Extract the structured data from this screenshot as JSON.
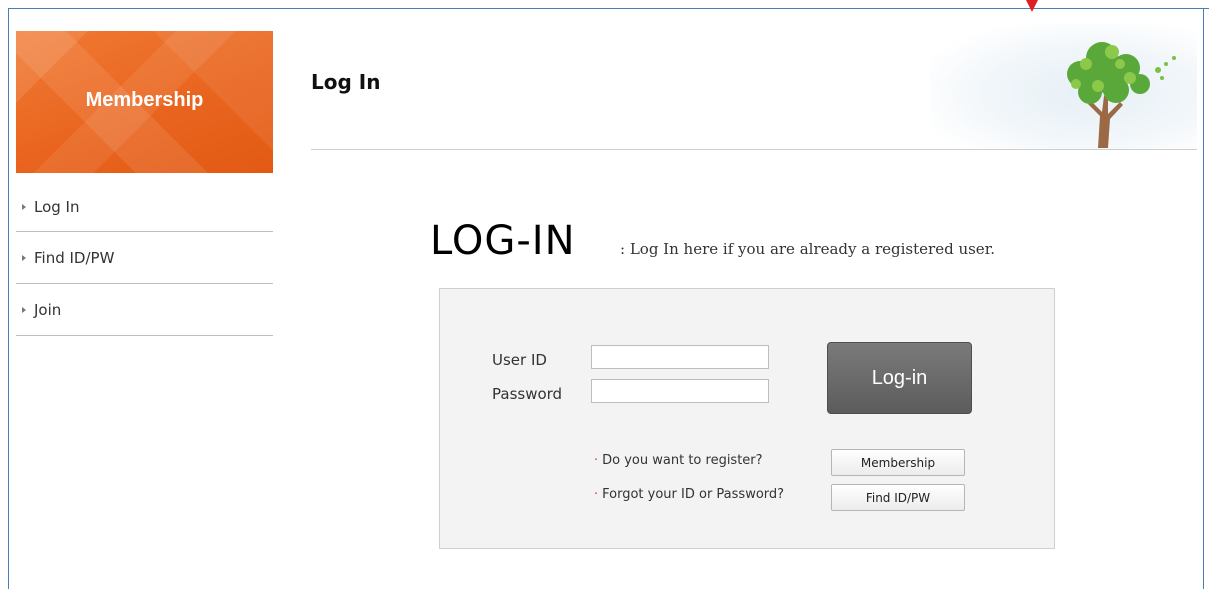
{
  "sidebar": {
    "banner_title": "Membership",
    "items": [
      {
        "label": "Log In"
      },
      {
        "label": "Find ID/PW"
      },
      {
        "label": "Join"
      }
    ]
  },
  "header": {
    "title": "Log In",
    "art_icon": "tree-illustration"
  },
  "login": {
    "heading": "LOG-IN",
    "subheading": ": Log In here if you are already a registered user.",
    "user_id_label": "User ID",
    "user_id_value": "",
    "password_label": "Password",
    "password_value": "",
    "submit_label": "Log-in",
    "register_prompt": "Do you want to register?",
    "register_button": "Membership",
    "forgot_prompt": "Forgot your ID or Password?",
    "forgot_button": "Find ID/PW"
  },
  "colors": {
    "banner": "#e9651f",
    "frame": "#4a7ebb",
    "marker": "#e02020",
    "login_button": "#666666",
    "bullet": "#d24a2a"
  }
}
